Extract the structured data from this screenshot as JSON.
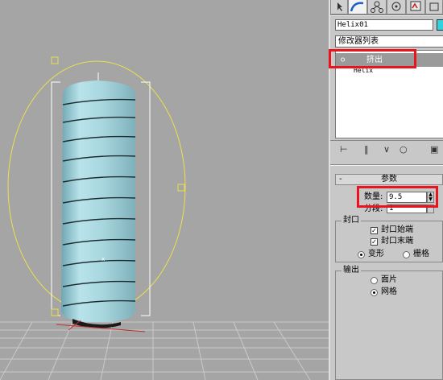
{
  "viewport": {
    "background": "#a5a5a5",
    "object_color": "#a8d8e0",
    "helix_color": "#ece04c",
    "icons": [
      "gizmo-box-icon",
      "gizmo-box-icon",
      "gizmo-box-icon"
    ]
  },
  "toolbar": {
    "icons": [
      "select-arrow-icon",
      "curve-icon",
      "hierarchy-icon",
      "motion-icon",
      "display-icon",
      "utilities-icon"
    ]
  },
  "object": {
    "name": "Helix01",
    "color": "#2fd4e0"
  },
  "modifier_list": {
    "label": "修改器列表"
  },
  "stack": {
    "items": [
      {
        "label": "挤出",
        "icon": "lightbulb-icon"
      },
      {
        "label": "Helix"
      }
    ]
  },
  "stack_tools": {
    "icons": [
      "pin-icon",
      "show-end-icon",
      "make-unique-icon",
      "remove-modifier-icon",
      "configure-icon"
    ]
  },
  "params": {
    "title": "参数",
    "collapse": "-",
    "amount_label": "数量:",
    "amount_value": "9.5",
    "segments_label": "分段:",
    "segments_value": "1",
    "capping": {
      "title": "封口",
      "cap_start": "封口始端",
      "cap_end": "封口末端",
      "cap_start_checked": true,
      "cap_end_checked": true,
      "morph": "变形",
      "grid": "栅格",
      "selected": "变形"
    },
    "output": {
      "title": "输出",
      "patch": "面片",
      "mesh": "网格",
      "selected": "网格"
    }
  },
  "highlight_color": "#e8141e"
}
